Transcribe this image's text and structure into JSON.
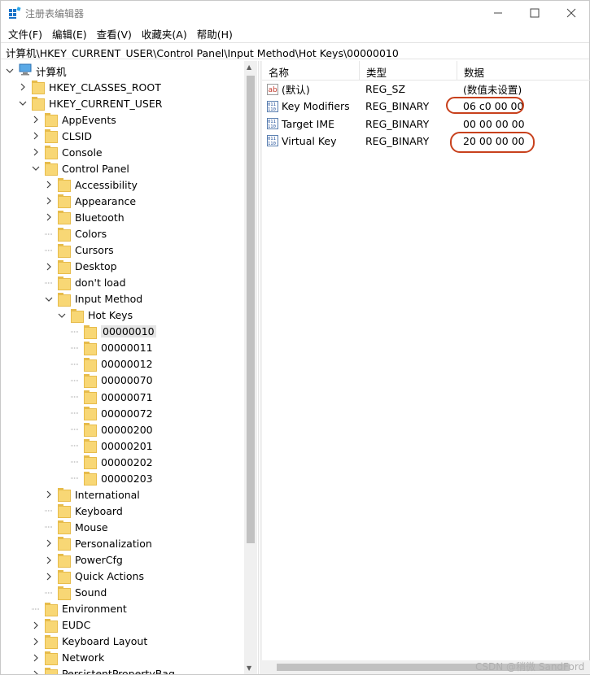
{
  "window": {
    "title": "注册表编辑器",
    "minimize": "—",
    "maximize": "☐",
    "close": "✕"
  },
  "menu": [
    "文件(F)",
    "编辑(E)",
    "查看(V)",
    "收藏夹(A)",
    "帮助(H)"
  ],
  "address": "计算机\\HKEY_CURRENT_USER\\Control Panel\\Input Method\\Hot Keys\\00000010",
  "tree": [
    {
      "label": "计算机",
      "level": 0,
      "expanded": true,
      "icon": "computer-icon"
    },
    {
      "label": "HKEY_CLASSES_ROOT",
      "level": 1,
      "expander": "collapsed"
    },
    {
      "label": "HKEY_CURRENT_USER",
      "level": 1,
      "expander": "expanded"
    },
    {
      "label": "AppEvents",
      "level": 2,
      "expander": "collapsed"
    },
    {
      "label": "CLSID",
      "level": 2,
      "expander": "collapsed"
    },
    {
      "label": "Console",
      "level": 2,
      "expander": "collapsed"
    },
    {
      "label": "Control Panel",
      "level": 2,
      "expander": "expanded"
    },
    {
      "label": "Accessibility",
      "level": 3,
      "expander": "collapsed"
    },
    {
      "label": "Appearance",
      "level": 3,
      "expander": "collapsed"
    },
    {
      "label": "Bluetooth",
      "level": 3,
      "expander": "collapsed"
    },
    {
      "label": "Colors",
      "level": 3,
      "expander": "none"
    },
    {
      "label": "Cursors",
      "level": 3,
      "expander": "none"
    },
    {
      "label": "Desktop",
      "level": 3,
      "expander": "collapsed"
    },
    {
      "label": "don't load",
      "level": 3,
      "expander": "none"
    },
    {
      "label": "Input Method",
      "level": 3,
      "expander": "expanded"
    },
    {
      "label": "Hot Keys",
      "level": 4,
      "expander": "expanded"
    },
    {
      "label": "00000010",
      "level": 5,
      "expander": "none",
      "selected": true
    },
    {
      "label": "00000011",
      "level": 5,
      "expander": "none"
    },
    {
      "label": "00000012",
      "level": 5,
      "expander": "none"
    },
    {
      "label": "00000070",
      "level": 5,
      "expander": "none"
    },
    {
      "label": "00000071",
      "level": 5,
      "expander": "none"
    },
    {
      "label": "00000072",
      "level": 5,
      "expander": "none"
    },
    {
      "label": "00000200",
      "level": 5,
      "expander": "none"
    },
    {
      "label": "00000201",
      "level": 5,
      "expander": "none"
    },
    {
      "label": "00000202",
      "level": 5,
      "expander": "none"
    },
    {
      "label": "00000203",
      "level": 5,
      "expander": "none"
    },
    {
      "label": "International",
      "level": 3,
      "expander": "collapsed"
    },
    {
      "label": "Keyboard",
      "level": 3,
      "expander": "none"
    },
    {
      "label": "Mouse",
      "level": 3,
      "expander": "none"
    },
    {
      "label": "Personalization",
      "level": 3,
      "expander": "collapsed"
    },
    {
      "label": "PowerCfg",
      "level": 3,
      "expander": "collapsed"
    },
    {
      "label": "Quick Actions",
      "level": 3,
      "expander": "collapsed"
    },
    {
      "label": "Sound",
      "level": 3,
      "expander": "none"
    },
    {
      "label": "Environment",
      "level": 2,
      "expander": "none"
    },
    {
      "label": "EUDC",
      "level": 2,
      "expander": "collapsed"
    },
    {
      "label": "Keyboard Layout",
      "level": 2,
      "expander": "collapsed"
    },
    {
      "label": "Network",
      "level": 2,
      "expander": "collapsed"
    },
    {
      "label": "PersistentPropertyBag",
      "level": 2,
      "expander": "collapsed"
    }
  ],
  "list": {
    "headers": [
      "名称",
      "类型",
      "数据"
    ],
    "rows": [
      {
        "name": "(默认)",
        "type": "REG_SZ",
        "data": "(数值未设置)",
        "icon": "string-value-icon",
        "highlight": false
      },
      {
        "name": "Key Modifiers",
        "type": "REG_BINARY",
        "data": "06 c0 00 00",
        "icon": "binary-value-icon",
        "highlight": true
      },
      {
        "name": "Target IME",
        "type": "REG_BINARY",
        "data": "00 00 00 00",
        "icon": "binary-value-icon",
        "highlight": false
      },
      {
        "name": "Virtual Key",
        "type": "REG_BINARY",
        "data": "20 00 00 00",
        "icon": "binary-value-icon",
        "highlight": true
      }
    ]
  },
  "highlight_color": "#c8411d",
  "watermark": "CSDN @稍微 SandFord"
}
